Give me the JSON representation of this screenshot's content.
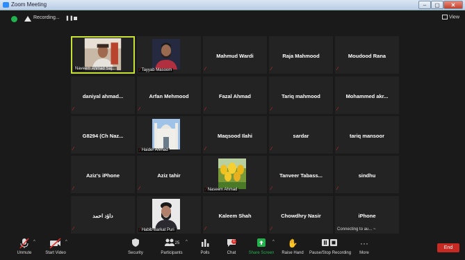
{
  "window": {
    "title": "Zoom Meeting",
    "minimize": "–",
    "maximize": "▢",
    "close": "✕"
  },
  "topbar": {
    "recording_label": "Recording...",
    "view_label": "View"
  },
  "tiles": [
    {
      "name": "",
      "label": "Naveem Ahmad Saj...",
      "type": "video"
    },
    {
      "name": "",
      "label": "Tayyab Masoom",
      "type": "video"
    },
    {
      "name": "Mahmud Wardi",
      "type": "name"
    },
    {
      "name": "Raja Mahmood",
      "type": "name"
    },
    {
      "name": "Moudood Rana",
      "type": "name"
    },
    {
      "name": "daniyal  ahmad...",
      "type": "name"
    },
    {
      "name": "Arfan Mehmood",
      "type": "name"
    },
    {
      "name": "Fazal Ahmad",
      "type": "name"
    },
    {
      "name": "Tariq mahmood",
      "type": "name"
    },
    {
      "name": "Mohammed  akr...",
      "type": "name"
    },
    {
      "name": "G8294 (Ch Naz...",
      "type": "name"
    },
    {
      "name": "",
      "label": "Haider Ahmad",
      "type": "video"
    },
    {
      "name": "Maqsood Ilahi",
      "type": "name"
    },
    {
      "name": "sardar",
      "type": "name"
    },
    {
      "name": "tariq mansoor",
      "type": "name"
    },
    {
      "name": "Aziz's iPhone",
      "type": "name"
    },
    {
      "name": "Aziz tahir",
      "type": "name"
    },
    {
      "name": "",
      "label": "Naseem Ahmad",
      "type": "video"
    },
    {
      "name": "Tanveer  Tabass...",
      "type": "name"
    },
    {
      "name": "sindhu",
      "type": "name"
    },
    {
      "name": "داؤد احمد",
      "type": "name"
    },
    {
      "name": "",
      "label": "Habib Barkat Puri",
      "type": "video"
    },
    {
      "name": "Kaleem Shah",
      "type": "name"
    },
    {
      "name": "Chowdhry Nasir",
      "type": "name"
    },
    {
      "name": "iPhone",
      "label": "Connecting to au... ~",
      "type": "connecting"
    }
  ],
  "toolbar": {
    "unmute": "Unmute",
    "start_video": "Start Video",
    "security": "Security",
    "participants": "Participants",
    "participants_count": "25",
    "polls": "Polls",
    "chat": "Chat",
    "chat_badge": "1",
    "share_screen": "Share Screen",
    "raise_hand": "Raise Hand",
    "pause_stop_recording": "Pause/Stop Recording",
    "more": "More",
    "end": "End",
    "more_icon": "···"
  },
  "colors": {
    "active_speaker": "#c9e234",
    "share_green": "#23b14d",
    "end_red": "#c72a22",
    "muted_red": "#e0302a"
  }
}
